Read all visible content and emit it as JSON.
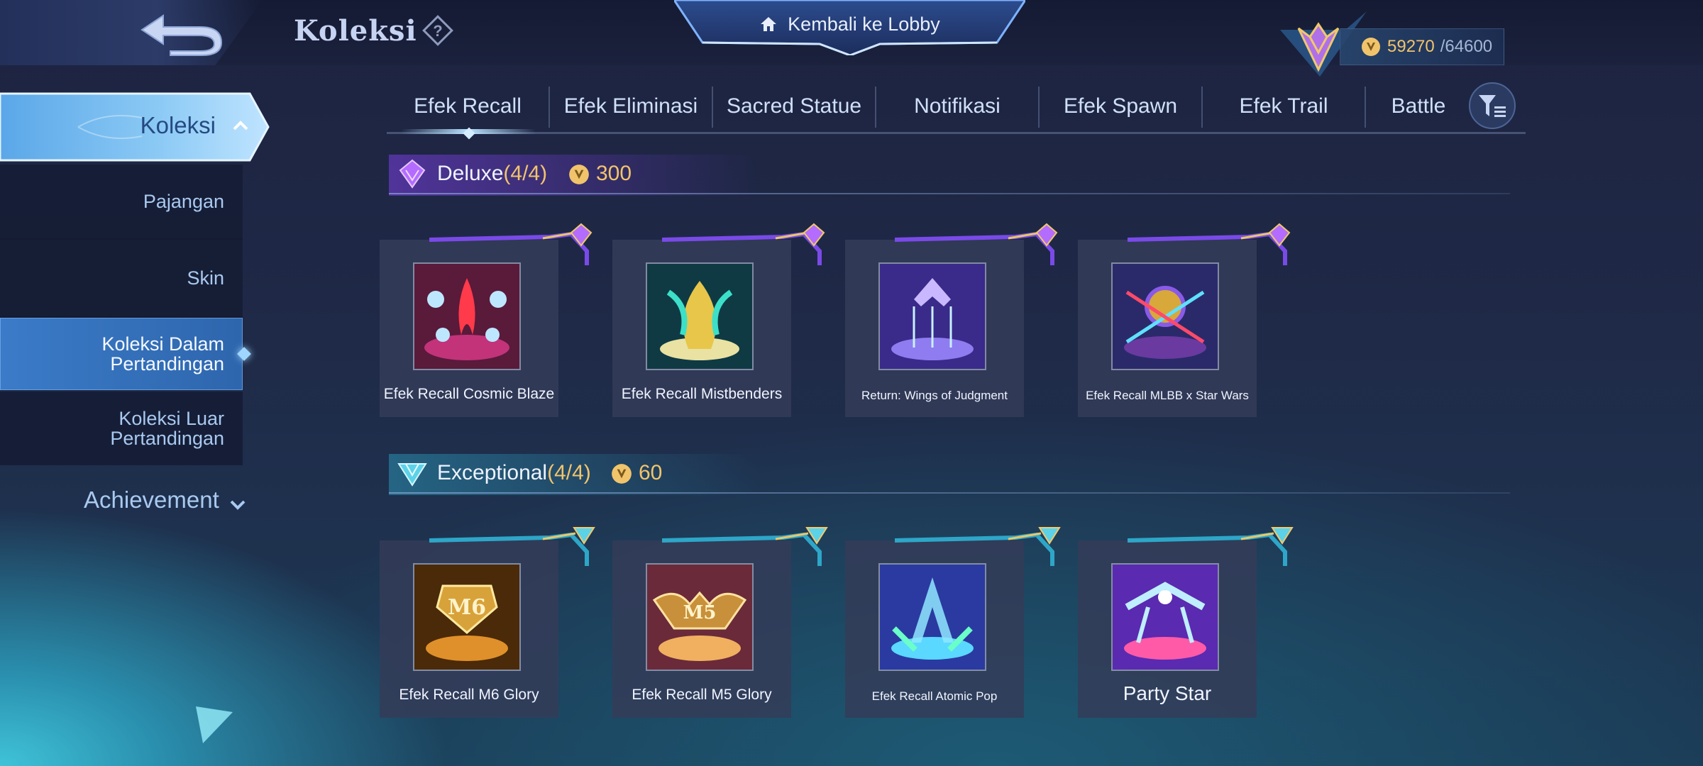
{
  "header": {
    "title": "Koleksi",
    "lobby_label": "Kembali ke Lobby",
    "currency_value": "59270",
    "currency_max": "/64600"
  },
  "sidebar": {
    "main_label": "Koleksi",
    "items": [
      {
        "label": "Pajangan"
      },
      {
        "label": "Skin"
      },
      {
        "label": "Koleksi Dalam Pertandingan",
        "active": true
      },
      {
        "label": "Koleksi Luar Pertandingan"
      }
    ],
    "achievement_label": "Achievement"
  },
  "tabs": [
    {
      "label": "Efek Recall",
      "active": true
    },
    {
      "label": "Efek Eliminasi"
    },
    {
      "label": "Sacred Statue"
    },
    {
      "label": "Notifikasi"
    },
    {
      "label": "Efek Spawn"
    },
    {
      "label": "Efek Trail"
    },
    {
      "label": "Battle"
    }
  ],
  "sections": [
    {
      "name": "Deluxe",
      "count": "(4/4)",
      "price": "300",
      "color": "#9b5cf0",
      "items": [
        {
          "label": "Efek Recall Cosmic Blaze"
        },
        {
          "label": "Efek Recall Mistbenders"
        },
        {
          "label": "Return: Wings of Judgment"
        },
        {
          "label": "Efek Recall MLBB x Star Wars"
        }
      ]
    },
    {
      "name": "Exceptional",
      "count": "(4/4)",
      "price": "60",
      "color": "#45b8d8",
      "items": [
        {
          "label": "Efek Recall M6 Glory"
        },
        {
          "label": "Efek Recall M5 Glory"
        },
        {
          "label": "Efek Recall Atomic Pop"
        },
        {
          "label": "Party Star"
        }
      ]
    }
  ],
  "colors": {
    "gold": "#f1c46c",
    "active_blue": "#3b7bc8",
    "text_light": "#dfe6f5"
  }
}
